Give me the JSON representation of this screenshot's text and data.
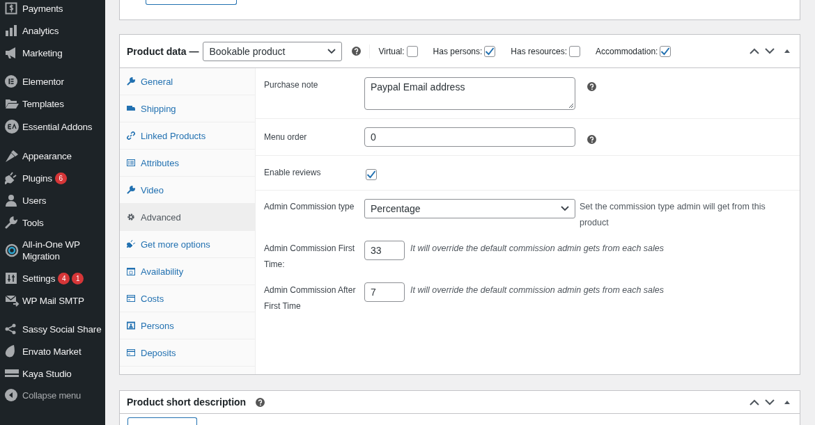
{
  "sidebar": {
    "groups": [
      [
        {
          "label": "Payments"
        },
        {
          "label": "Analytics"
        },
        {
          "label": "Marketing"
        }
      ],
      [
        {
          "label": "Elementor"
        },
        {
          "label": "Templates"
        },
        {
          "label": "Essential Addons"
        }
      ],
      [
        {
          "label": "Appearance"
        },
        {
          "label": "Plugins",
          "badges": [
            "6"
          ]
        },
        {
          "label": "Users"
        },
        {
          "label": "Tools"
        },
        {
          "label": "All-in-One WP Migration"
        },
        {
          "label": "Settings",
          "badges": [
            "4",
            "1"
          ]
        },
        {
          "label": "WP Mail SMTP"
        }
      ],
      [
        {
          "label": "Sassy Social Share"
        },
        {
          "label": "Envato Market"
        },
        {
          "label": "Kaya Studio"
        }
      ]
    ],
    "collapse": "Collapse menu"
  },
  "product_data": {
    "title": "Product data —",
    "product_type": "Bookable product",
    "options": [
      {
        "label": "Virtual:",
        "checked": false
      },
      {
        "label": "Has persons:",
        "checked": true
      },
      {
        "label": "Has resources:",
        "checked": false
      },
      {
        "label": "Accommodation:",
        "checked": true
      }
    ],
    "tabs": [
      {
        "label": "General",
        "selected": false
      },
      {
        "label": "Shipping",
        "selected": false
      },
      {
        "label": "Linked Products",
        "selected": false
      },
      {
        "label": "Attributes",
        "selected": false
      },
      {
        "label": "Video",
        "selected": false
      },
      {
        "label": "Advanced",
        "selected": true
      },
      {
        "label": "Get more options",
        "selected": false
      },
      {
        "label": "Availability",
        "selected": false
      },
      {
        "label": "Costs",
        "selected": false
      },
      {
        "label": "Persons",
        "selected": false
      },
      {
        "label": "Deposits",
        "selected": false
      }
    ],
    "sections": [
      [
        {
          "kind": "textarea",
          "label": "Purchase note",
          "value": "Paypal Email address",
          "help": true
        }
      ],
      [
        {
          "kind": "text",
          "label": "Menu order",
          "value": "0",
          "help": true
        }
      ],
      [
        {
          "kind": "checkbox",
          "label": "Enable reviews",
          "checked": true
        }
      ],
      [
        {
          "kind": "select",
          "label": "Admin Commission type",
          "value": "Percentage",
          "description": "Set the commission type admin will get from this product"
        },
        {
          "kind": "number",
          "label": "Admin Commission First Time:",
          "value": "33",
          "description": "It will override the default commission admin gets from each sales"
        },
        {
          "kind": "number",
          "label": "Admin Commission After First Time",
          "value": "7",
          "description": "It will override the default commission admin gets from each sales"
        }
      ]
    ]
  },
  "short_description": {
    "title": "Product short description"
  }
}
